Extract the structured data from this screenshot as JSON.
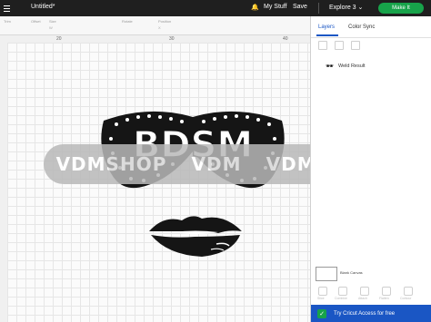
{
  "app": {
    "document_title": "Untitled*",
    "my_stuff": "My Stuff",
    "save": "Save",
    "project_selector": "Explore 3",
    "make_button": "Make It"
  },
  "toolbar": {
    "labels": [
      "Trim",
      "Offset",
      "Size",
      "Rotate",
      "Position"
    ],
    "values": [
      "",
      "",
      "W",
      "",
      "X"
    ]
  },
  "rulers": {
    "top": [
      "20",
      "30",
      "40"
    ]
  },
  "watermark": {
    "words": [
      "VDMSHOP",
      "VDM",
      "VDMSHOP"
    ]
  },
  "design": {
    "mask_text": "BDSM"
  },
  "panel": {
    "tabs": [
      "Layers",
      "Color Sync"
    ],
    "layer_item": "Weld Result",
    "blank_canvas": "Blank Canvas",
    "bottom_actions": [
      "Slice",
      "Combine",
      "Attach",
      "Flatten",
      "Contour"
    ],
    "access_banner": "Try Cricut Access for free"
  },
  "colors": {
    "topbar": "#1f1f1f",
    "make_button": "#17a34a",
    "accent": "#1a56c4"
  }
}
